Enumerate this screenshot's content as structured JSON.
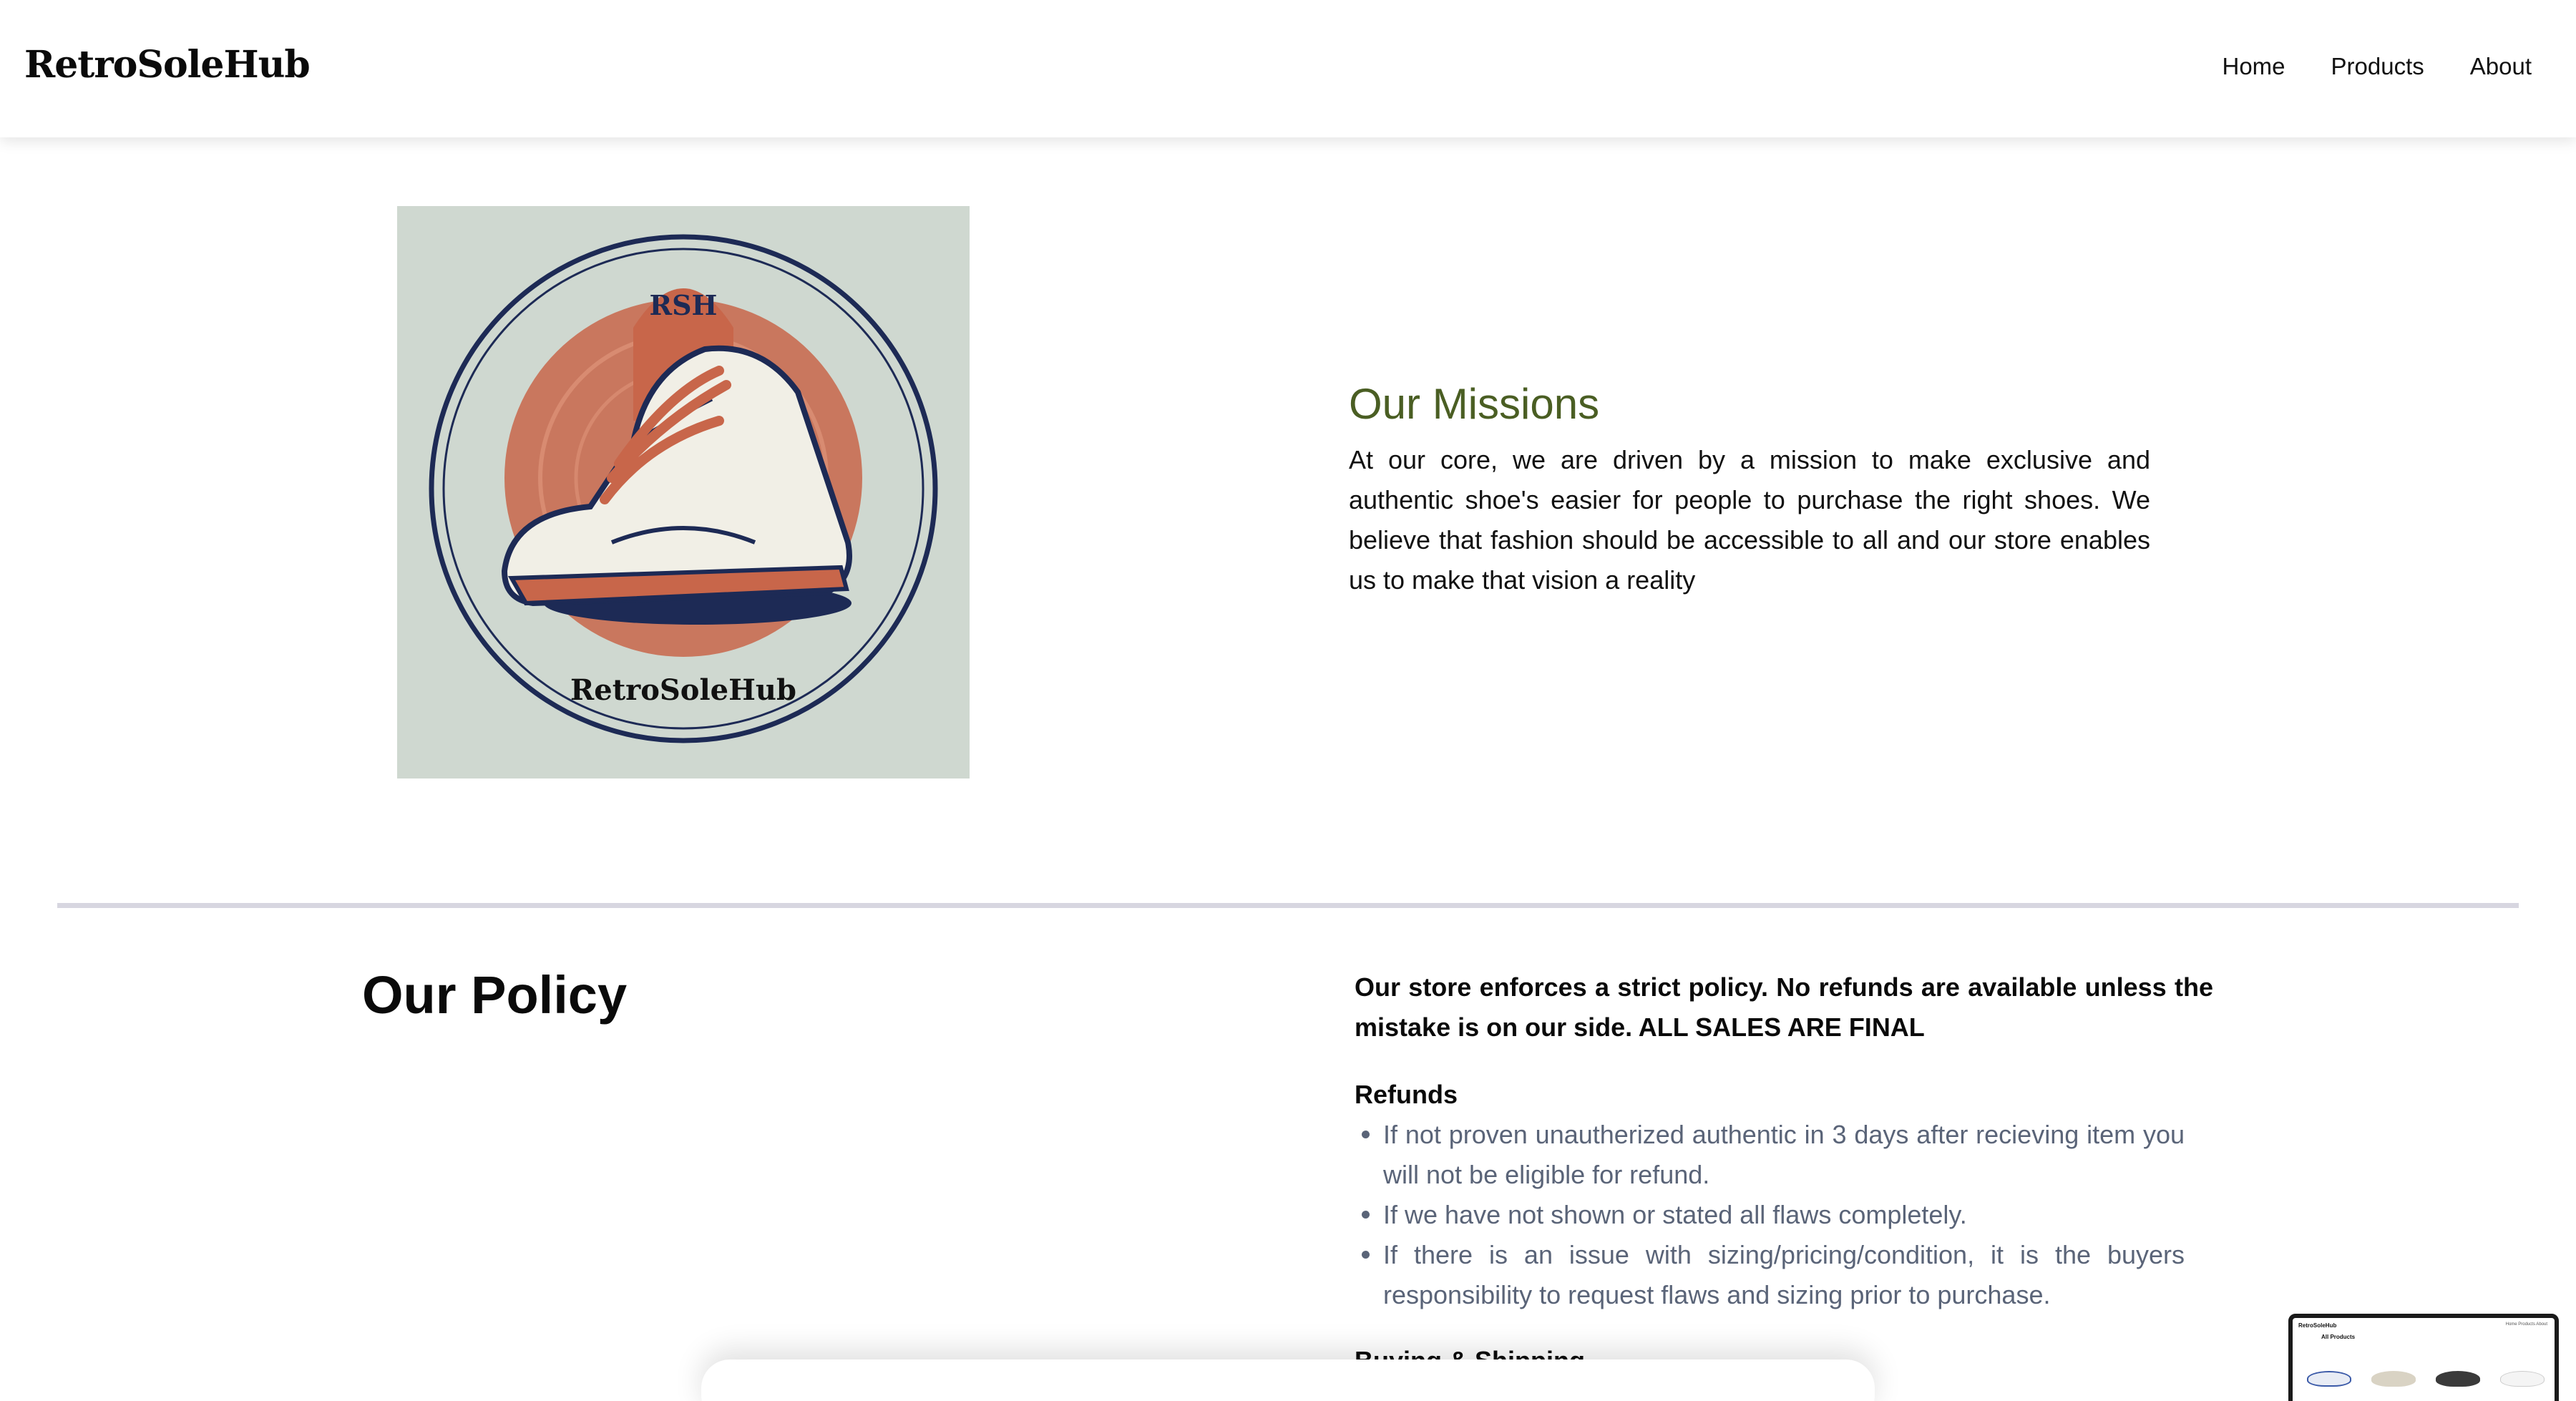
{
  "header": {
    "logo": "RetroSoleHub",
    "nav": [
      "Home",
      "Products",
      "About"
    ]
  },
  "mission": {
    "image_logo_text_top": "RSH",
    "image_logo_text_bottom": "RetroSoleHub",
    "title": "Our Missions",
    "body": "At our core, we are driven by a mission to make exclusive and authentic shoe's easier for people to purchase the right shoes. We believe that fashion should be accessible to all and our store enables us to make that vision a reality"
  },
  "policy": {
    "title": "Our Policy",
    "intro": "Our store enforces a strict policy. No refunds are available unless the mistake is on our side. ALL SALES ARE FINAL",
    "refunds_heading": "Refunds",
    "refunds": [
      "If not proven unautherized authentic in 3 days after recieving item you will not be eligible for refund.",
      "If we have not shown or stated all flaws completely.",
      "If there is an issue with sizing/pricing/condition, it is the buyers responsibility to request flaws and sizing prior to purchase."
    ],
    "buying_heading": "Buying & Shipping"
  },
  "thumbnail": {
    "brand": "RetroSoleHub",
    "nav": "Home  Products  About",
    "title": "All Products"
  },
  "colors": {
    "mission_title": "#4a5e23",
    "list_text": "#5a6478",
    "divider": "#d7d6e0",
    "logo_bg": "#cfd8d0",
    "logo_accent": "#c8664a",
    "logo_navy": "#1d2a55"
  }
}
